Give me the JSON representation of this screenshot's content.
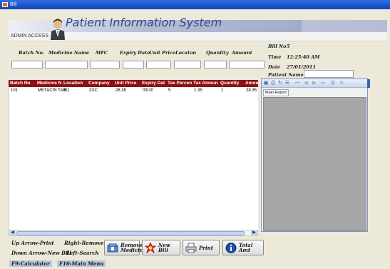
{
  "window": {
    "title": "Bill"
  },
  "header": {
    "title": "Patient Information System",
    "user": "ADMIN ACCESS"
  },
  "entry": {
    "labels": [
      "Batch No.",
      "Medicine Name",
      "MFC",
      "Expiry Date",
      "Unit Price",
      "Locaton",
      "Quantity",
      "Amount"
    ]
  },
  "bill": {
    "bill_no_label": "Bill No",
    "bill_no": "5",
    "time_label": "Time",
    "time": "12:25:40 AM",
    "date_label": "Date",
    "date": "27/01/2011",
    "patient_label": "Patient Name"
  },
  "grid": {
    "columns": [
      "Batch No",
      "Medicine N",
      "Location",
      "Company",
      "Unit Price",
      "Expiry Dat",
      "Tax Percen",
      "Tax Amoun",
      "Quantity",
      "Amou"
    ],
    "rows": [
      [
        "101",
        "METACIN TAB",
        "B1",
        "ZXC",
        "28.35",
        "03/10",
        "5",
        "1.35",
        "1",
        "28.35"
      ]
    ]
  },
  "report": {
    "tab_label": "Main Report"
  },
  "hints": {
    "up": "Up Arrow-Print",
    "right": "Right-Remove",
    "down": "Down Arrow-New Bill",
    "left": "Left-Search",
    "f9": "F9-Calculator",
    "f10": "F10-Main Menu"
  },
  "buttons": {
    "remove_line1": "Remove",
    "remove_line2": "Medicine",
    "new_bill": "New Bill",
    "print": "Print",
    "total": "Total Amt"
  }
}
